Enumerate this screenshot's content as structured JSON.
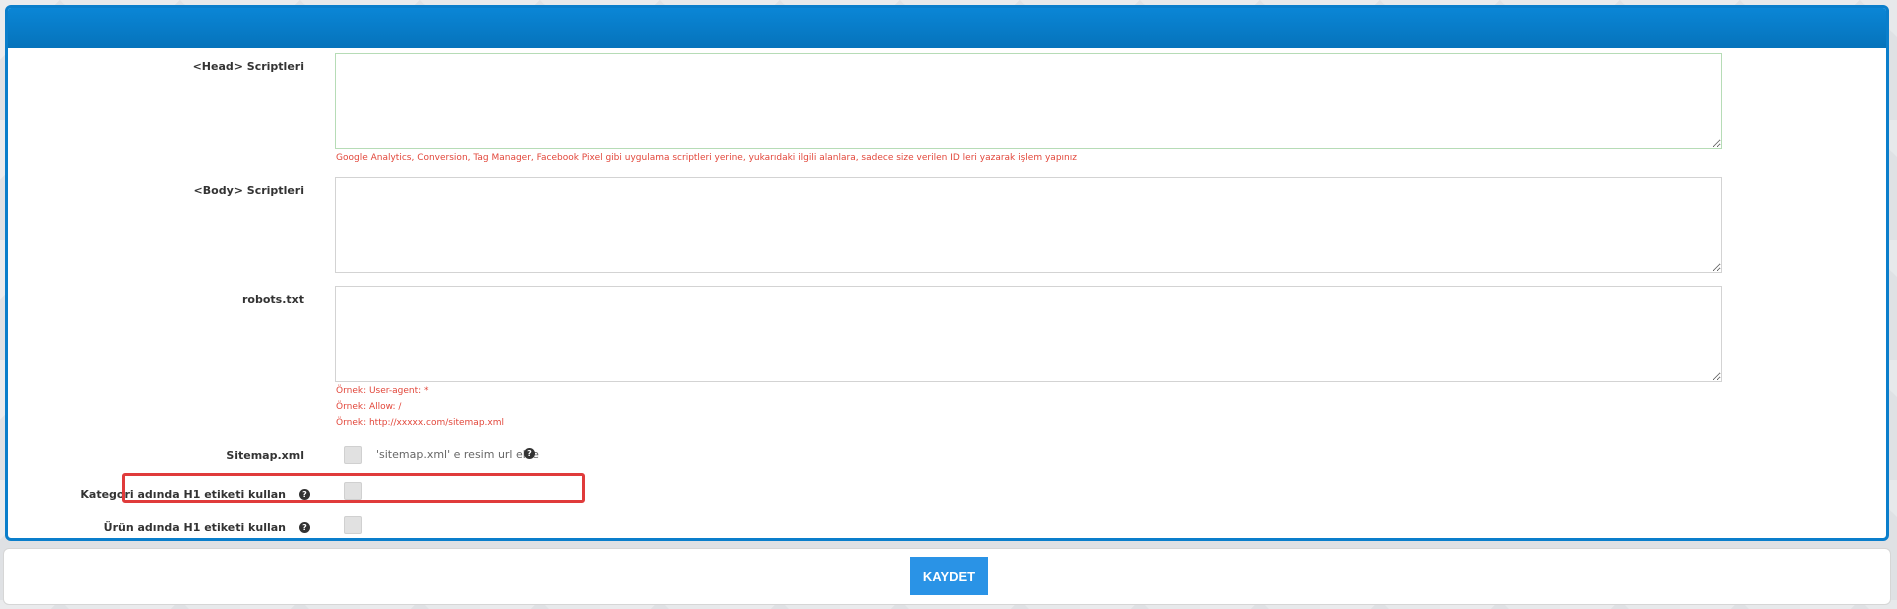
{
  "form": {
    "head_scripts": {
      "label": "<Head> Scriptleri",
      "value": "",
      "hint": "Google Analytics, Conversion, Tag Manager, Facebook Pixel gibi uygulama scriptleri yerine, yukarıdaki ilgili alanlara, sadece size verilen ID leri yazarak işlem yapınız"
    },
    "body_scripts": {
      "label": "<Body> Scriptleri",
      "value": ""
    },
    "robots_txt": {
      "label": "robots.txt",
      "value": "",
      "hints": [
        "Örnek: User-agent: *",
        "Örnek: Allow: /",
        "Örnek: http://xxxxx.com/sitemap.xml"
      ]
    },
    "sitemap": {
      "label": "Sitemap.xml",
      "checkbox_text": "'sitemap.xml' e resim url ekle",
      "checked": false,
      "help_icon": "question-circle-icon"
    },
    "category_h1": {
      "label": "Kategori adında H1 etiketi kullan",
      "checked": false,
      "help_icon": "question-circle-icon"
    },
    "product_h1": {
      "label": "Ürün adında H1 etiketi kullan",
      "checked": false,
      "help_icon": "question-circle-icon"
    }
  },
  "footer": {
    "save_label": "KAYDET"
  },
  "colors": {
    "header_blue": "#0a7ecb",
    "hint_red": "#e2473b",
    "highlight_red": "#e03b3b",
    "button_blue": "#2a93e6"
  }
}
